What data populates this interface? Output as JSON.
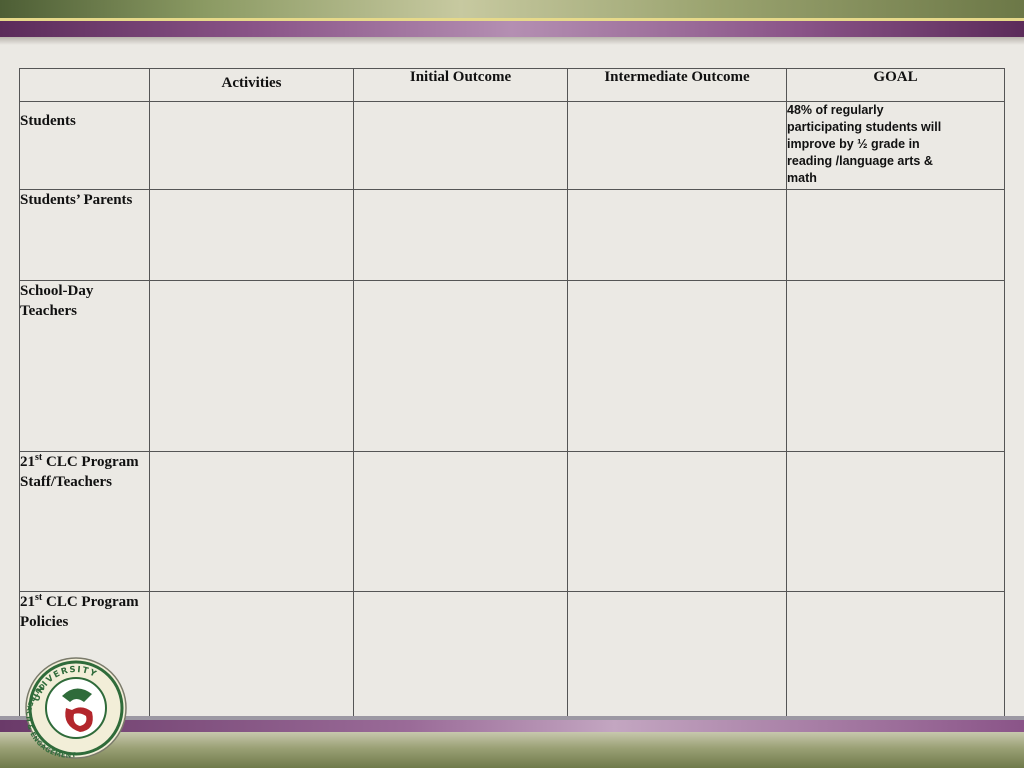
{
  "table": {
    "headers": [
      "",
      "Activities",
      "Initial Outcome",
      "Intermediate Outcome",
      "GOAL"
    ],
    "rows": [
      {
        "label": "Students"
      },
      {
        "label": "Students’ Parents"
      },
      {
        "label": "School-Day Teachers"
      },
      {
        "label_parts": {
          "num": "21",
          "sup": "st",
          "rest": " CLC Program Staff/Teachers"
        }
      },
      {
        "label_parts": {
          "num": "21",
          "sup": "st",
          "rest": " CLC Program Policies"
        }
      }
    ],
    "goal_text": "48% of regularly participating students will improve by ½ grade in reading /language arts & math"
  },
  "logo": {
    "text": "UNIVERSITY OUTREACH & ENGAGEMENT",
    "colors": {
      "green": "#2f6b3a",
      "red": "#b3262c",
      "gold": "#d9c46a"
    }
  },
  "theme": {
    "purple": "#8a5488",
    "olive": "#7d8a52",
    "background": "#ebe9e4"
  }
}
